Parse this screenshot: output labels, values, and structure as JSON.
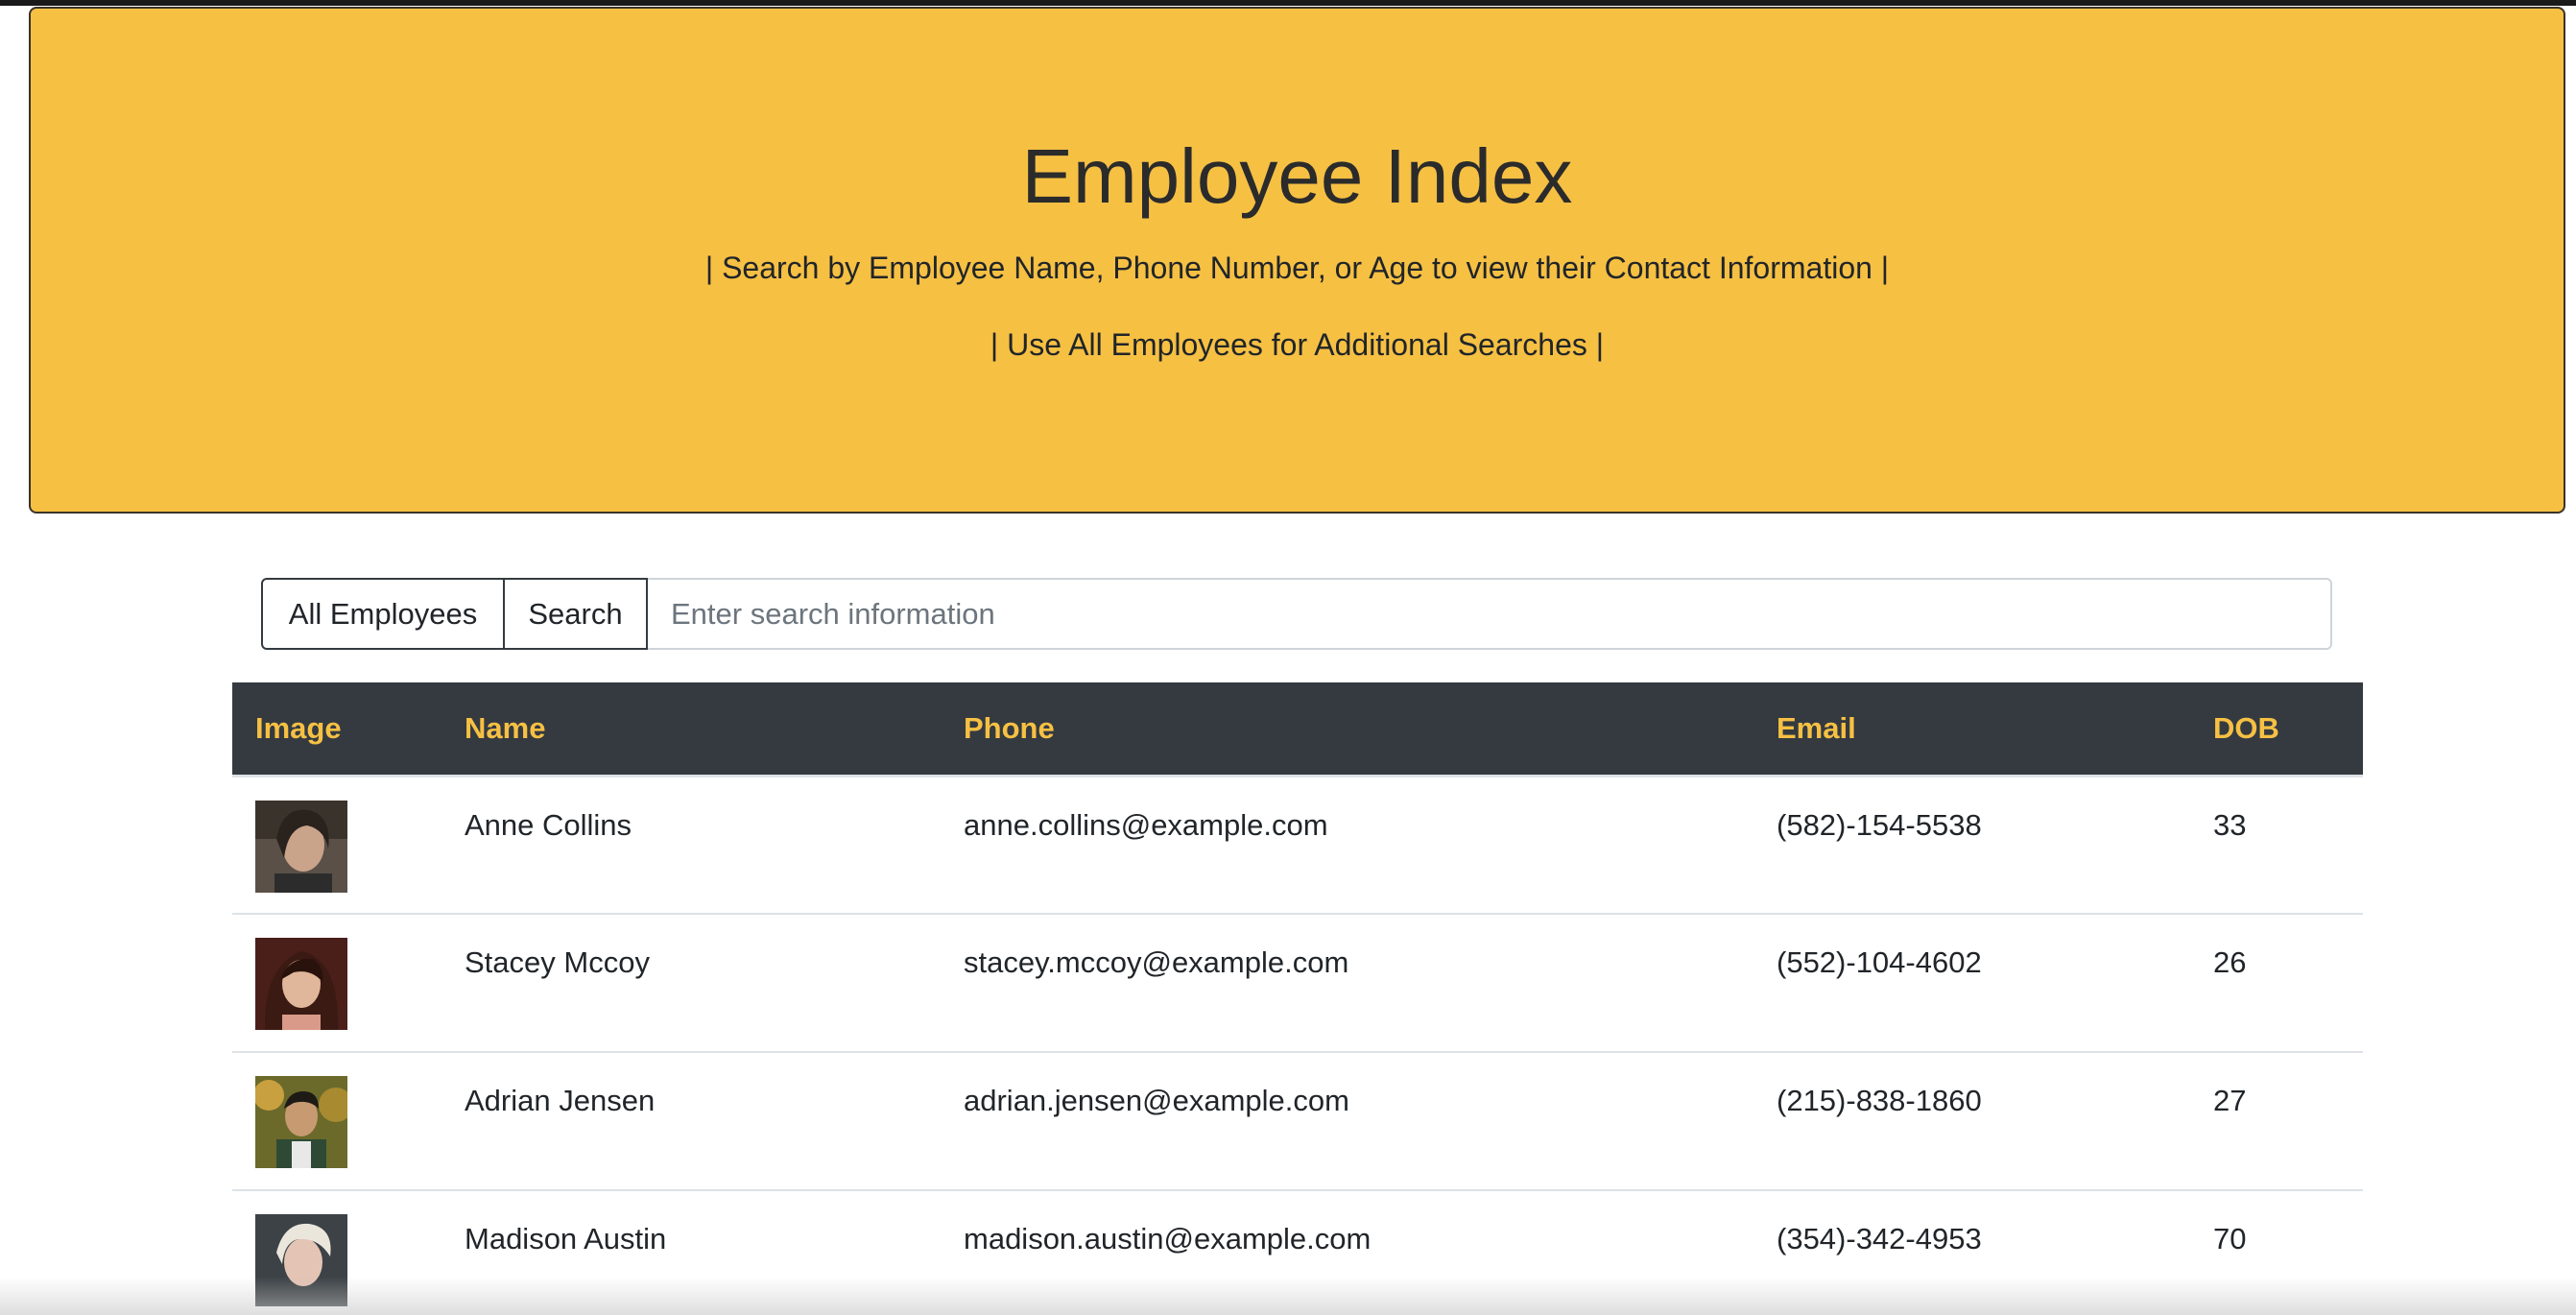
{
  "header": {
    "title": "Employee Index",
    "subtitle_1": "| Search by Employee Name, Phone Number, or Age to view their Contact Information |",
    "subtitle_2": "| Use All Employees for Additional Searches |"
  },
  "search": {
    "all_label": "All Employees",
    "search_label": "Search",
    "placeholder": "Enter search information",
    "value": ""
  },
  "table": {
    "columns": [
      "Image",
      "Name",
      "Phone",
      "Email",
      "DOB"
    ],
    "rows": [
      {
        "name": "Anne Collins",
        "phone": "anne.collins@example.com",
        "email": "(582)-154-5538",
        "dob": "33"
      },
      {
        "name": "Stacey Mccoy",
        "phone": "stacey.mccoy@example.com",
        "email": "(552)-104-4602",
        "dob": "26"
      },
      {
        "name": "Adrian Jensen",
        "phone": "adrian.jensen@example.com",
        "email": "(215)-838-1860",
        "dob": "27"
      },
      {
        "name": "Madison Austin",
        "phone": "madison.austin@example.com",
        "email": "(354)-342-4953",
        "dob": "70"
      }
    ]
  },
  "colors": {
    "accent": "#f6c043",
    "table_header_bg": "#343a40"
  }
}
